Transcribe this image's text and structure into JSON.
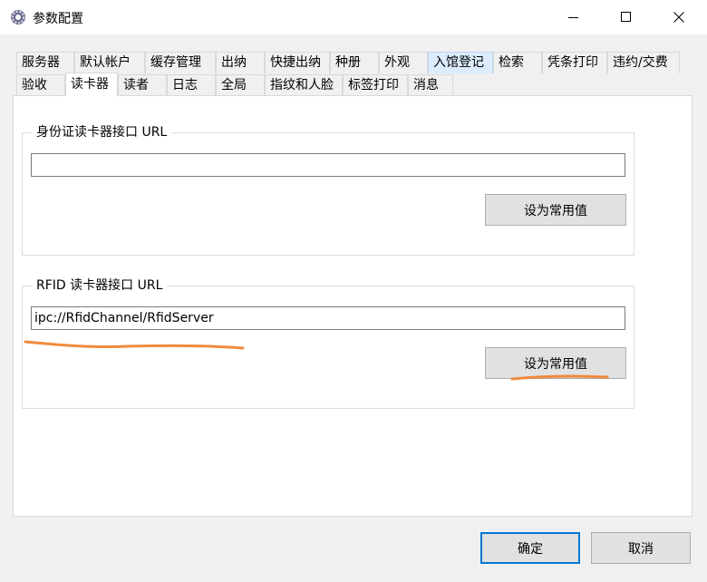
{
  "window": {
    "title": "参数配置",
    "icon": "gear-app-icon",
    "controls": {
      "minimize": "minimize-icon",
      "maximize": "maximize-icon",
      "close": "close-icon"
    }
  },
  "tabs_row1": [
    {
      "label": "服务器"
    },
    {
      "label": "默认帐户"
    },
    {
      "label": "缓存管理"
    },
    {
      "label": "出纳"
    },
    {
      "label": "快捷出纳"
    },
    {
      "label": "种册"
    },
    {
      "label": "外观"
    },
    {
      "label": "入馆登记"
    },
    {
      "label": "检索"
    },
    {
      "label": "凭条打印"
    },
    {
      "label": "违约/交费"
    }
  ],
  "tabs_row2": [
    {
      "label": "验收"
    },
    {
      "label": "读卡器"
    },
    {
      "label": "读者"
    },
    {
      "label": "日志"
    },
    {
      "label": "全局"
    },
    {
      "label": "指纹和人脸"
    },
    {
      "label": "标签打印"
    },
    {
      "label": "消息"
    }
  ],
  "active_tab": "读卡器",
  "id_card_group": {
    "title": "身份证读卡器接口 URL",
    "url_value": "",
    "set_default_label": "设为常用值"
  },
  "rfid_group": {
    "title": "RFID 读卡器接口 URL",
    "url_value": "ipc://RfidChannel/RfidServer",
    "set_default_label": "设为常用值"
  },
  "footer": {
    "ok_label": "确定",
    "cancel_label": "取消"
  },
  "colors": {
    "accent": "#0078d7",
    "highlight_tab": "#dcecfc",
    "annotation": "#f08a3c"
  }
}
